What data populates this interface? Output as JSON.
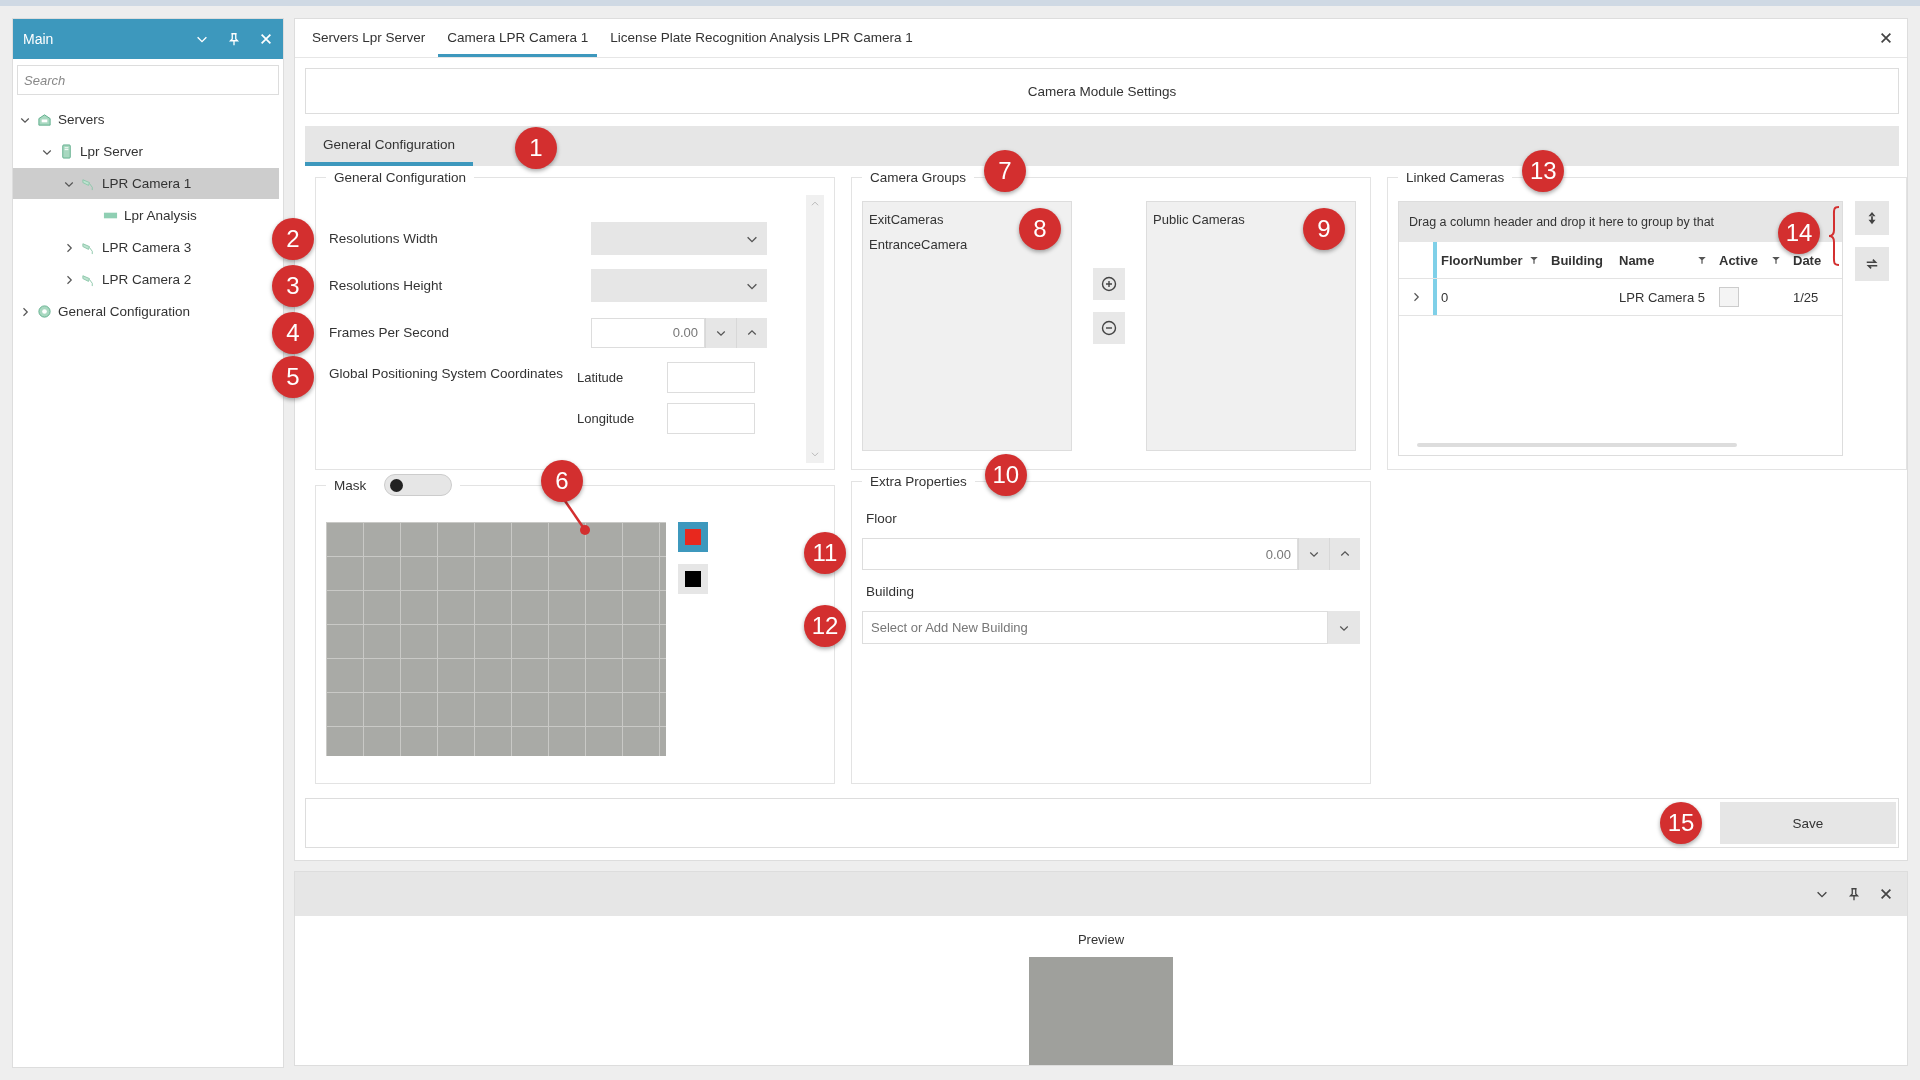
{
  "main_panel": {
    "title": "Main",
    "search": {
      "placeholder": "Search"
    },
    "tree": [
      {
        "label": "Servers",
        "kind": "group",
        "expanded": true,
        "selected": false,
        "children": [
          {
            "label": "Lpr Server",
            "kind": "server",
            "expanded": true,
            "selected": false,
            "children": [
              {
                "label": "LPR Camera 1",
                "kind": "camera",
                "expanded": true,
                "selected": true,
                "children": [
                  {
                    "label": "Lpr Analysis",
                    "kind": "analysis",
                    "selected": false
                  }
                ]
              },
              {
                "label": "LPR Camera 3",
                "kind": "camera",
                "expanded": false,
                "selected": false
              },
              {
                "label": "LPR Camera 2",
                "kind": "camera",
                "expanded": false,
                "selected": false
              }
            ]
          }
        ]
      },
      {
        "label": "General Configuration",
        "kind": "settings",
        "expanded": false,
        "selected": false
      }
    ]
  },
  "document_tabs": [
    {
      "label": "Servers Lpr Server",
      "selected": false
    },
    {
      "label": "Camera LPR Camera 1",
      "selected": true
    },
    {
      "label": "License Plate Recognition Analysis LPR Camera 1",
      "selected": false
    }
  ],
  "settings_title": "Camera Module Settings",
  "inner_tabs": [
    {
      "label": "General Configuration",
      "selected": true,
      "callout": "1"
    }
  ],
  "general_configuration": {
    "title": "General Configuration",
    "fields": [
      {
        "kind": "dropdown",
        "label": "Resolutions Width",
        "callout": "2"
      },
      {
        "kind": "dropdown",
        "label": "Resolutions Height",
        "callout": "3"
      },
      {
        "kind": "spinner",
        "label": "Frames Per Second",
        "value": "0.00",
        "callout": "4"
      },
      {
        "kind": "coordinates",
        "label": "Global Positioning System Coordinates",
        "callout": "5",
        "latitude_label": "Latitude",
        "longitude_label": "Longitude"
      }
    ]
  },
  "camera_groups": {
    "title": "Camera Groups",
    "callout": "7",
    "available": {
      "items": [
        "ExitCameras",
        "EntranceCamera"
      ],
      "callout": "8"
    },
    "assigned": {
      "items": [
        "Public Cameras"
      ],
      "callout": "9"
    }
  },
  "linked_cameras": {
    "title": "Linked Cameras",
    "callout": "13",
    "group_panel": "Drag a column header and drop it here to group by that",
    "group_callout": "14",
    "columns": [
      {
        "label": "FloorNumber",
        "filter": true
      },
      {
        "label": "Building",
        "filter": false
      },
      {
        "label": "Name",
        "filter": true
      },
      {
        "label": "Active",
        "filter": true
      },
      {
        "label": "Date",
        "filter": false
      }
    ],
    "rows": [
      {
        "floor_number": "0",
        "name": "LPR Camera 5",
        "active": false,
        "date": "1/25"
      }
    ]
  },
  "mask": {
    "label": "Mask",
    "on": false,
    "callout": "6",
    "colors": [
      {
        "color": "#e8281e",
        "selected": true
      },
      {
        "color": "#000000",
        "selected": false
      }
    ]
  },
  "extra_properties": {
    "title": "Extra Properties",
    "callout": "10",
    "floor": {
      "label": "Floor",
      "value": "0.00",
      "callout": "11"
    },
    "building": {
      "label": "Building",
      "placeholder": "Select or Add New Building",
      "callout": "12"
    }
  },
  "save": {
    "label": "Save",
    "callout": "15"
  },
  "preview_panel": {
    "title": "Preview"
  }
}
